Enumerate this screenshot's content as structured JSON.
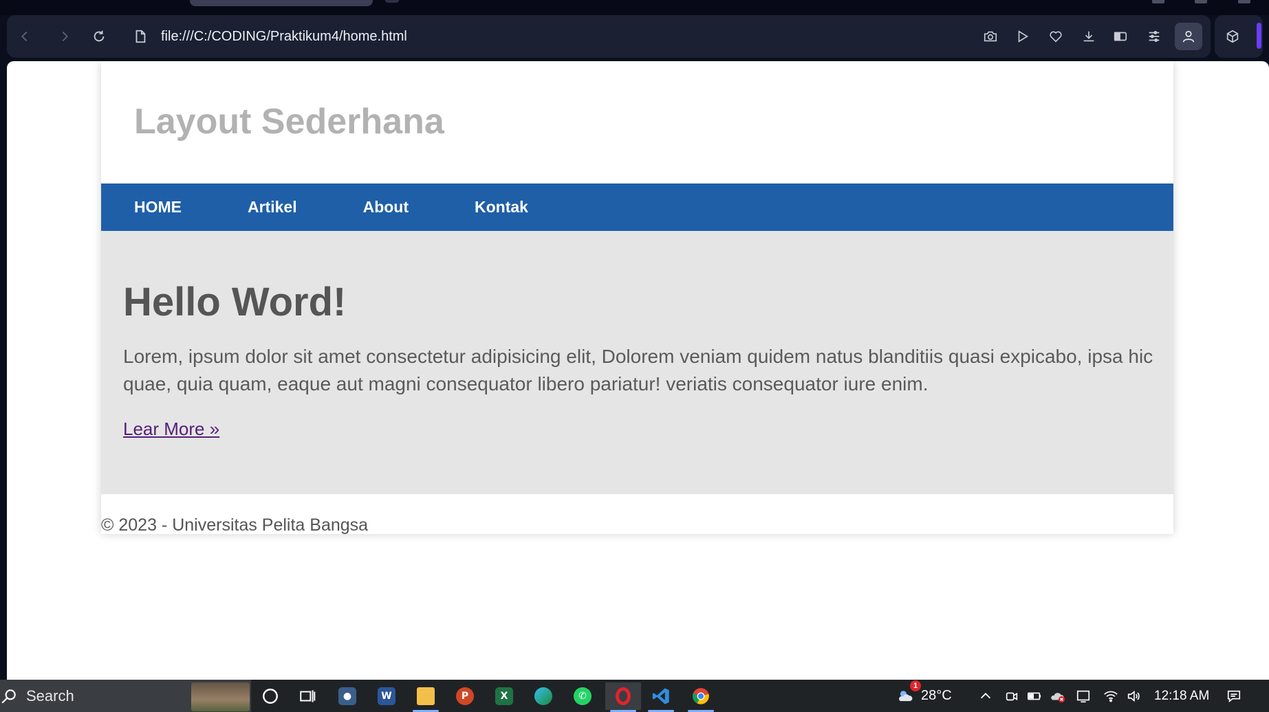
{
  "browser": {
    "url": "file:///C:/CODING/Praktikum4/home.html",
    "accent_color": "#6b3cff",
    "toolbar_icons": [
      "back-icon",
      "forward-icon",
      "reload-icon",
      "file-icon",
      "camera-icon",
      "play-icon",
      "heart-icon",
      "download-icon",
      "wallet-icon",
      "easy-setup-icon",
      "profile-icon",
      "extensions-icon"
    ]
  },
  "page": {
    "site_title": "Layout Sederhana",
    "nav": [
      {
        "label": "HOME"
      },
      {
        "label": "Artikel"
      },
      {
        "label": "About"
      },
      {
        "label": "Kontak"
      }
    ],
    "nav_color": "#1f5fa8",
    "hero": {
      "title": "Hello Word!",
      "text": "Lorem, ipsum dolor sit amet consectetur adipisicing elit, Dolorem veniam quidem natus blanditiis quasi expicabo, ipsa hic quae, quia quam, eaque aut magni consequator libero pariatur! veriatis consequator iure enim.",
      "link": "Lear More »"
    },
    "footer": "© 2023 - Universitas Pelita Bangsa"
  },
  "taskbar": {
    "search_placeholder": "Search",
    "apps": [
      "cortana-icon",
      "task-view-icon",
      "camera-app-icon",
      "word-icon",
      "file-explorer-icon",
      "powerpoint-icon",
      "excel-icon",
      "edge-icon",
      "whatsapp-icon",
      "opera-icon",
      "vscode-icon",
      "chrome-icon"
    ],
    "weather_badge": "1",
    "temperature": "28°C",
    "time": "12:18 AM"
  }
}
